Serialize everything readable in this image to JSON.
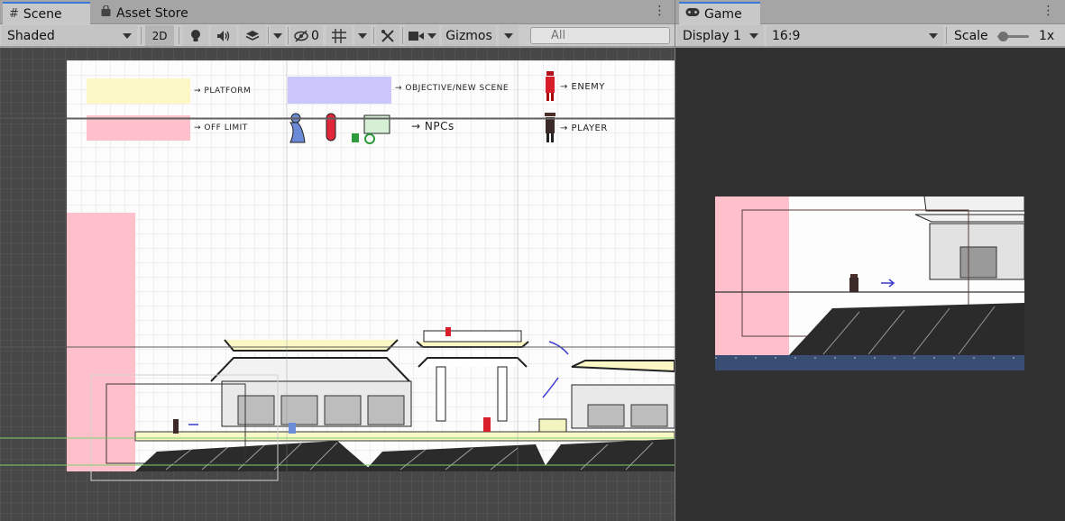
{
  "scene_panel": {
    "tabs": [
      {
        "label": "Scene",
        "icon": "hash-icon",
        "active": true
      },
      {
        "label": "Asset Store",
        "icon": "bag-icon",
        "active": false
      }
    ],
    "toolbar": {
      "shading_mode": "Shaded",
      "toggle_2d": "2D",
      "hidden_count": "0",
      "gizmos_label": "Gizmos",
      "search_placeholder": "All"
    }
  },
  "legend": {
    "platform": "→ PLATFORM",
    "off_limit": "→ OFF LIMIT",
    "objective": "→ OBJECTIVE/NEW SCENE",
    "npcs": "→ NPCs",
    "enemy": "→ ENEMY",
    "player": "→ PLAYER"
  },
  "game_panel": {
    "tab": {
      "label": "Game",
      "icon": "gamepad-icon"
    },
    "toolbar": {
      "display": "Display 1",
      "aspect": "16:9",
      "scale_label": "Scale",
      "scale_value": "1x"
    }
  },
  "colors": {
    "platform_yellow": "#fbf8c6",
    "off_limit_pink": "#ffc0cb",
    "objective_purple": "#cbc6fb",
    "active_tab_accent": "#3a79d8",
    "game_ground_blue": "#3a4d73"
  }
}
